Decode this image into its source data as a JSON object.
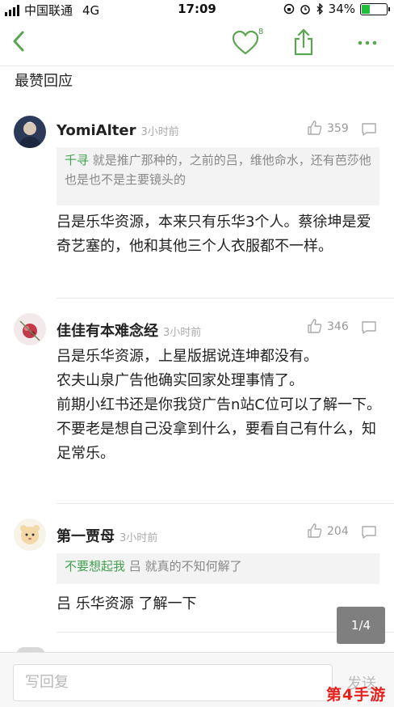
{
  "status_bar": {
    "carrier": "中国联通",
    "network": "4G",
    "time": "17:09",
    "battery": "34%",
    "battery_level": 0.34
  },
  "nav": {
    "like_count": "8"
  },
  "section_title": "最赞回应",
  "comments": [
    {
      "name": "YomiAlter",
      "time": "3小时前",
      "likes": "359",
      "quote_name": "千寻",
      "quote_text": "就是推广那种的，之前的吕，维他命水，还有芭莎他也是也不是主要镜头的",
      "body": "吕是乐华资源，本来只有乐华3个人。蔡徐坤是爱奇艺塞的，他和其他三个人衣服都不一样。"
    },
    {
      "name": "佳佳有本难念经",
      "time": "3小时前",
      "likes": "346",
      "body_lines": [
        "吕是乐华资源，上星版据说连坤都没有。",
        "农夫山泉广告他确实回家处理事情了。",
        "前期小红书还是你我贷广告n站C位可以了解一下。",
        "不要老是想自己没拿到什么，要看自己有什么，知足常乐。"
      ]
    },
    {
      "name": "第一贾母",
      "time": "3小时前",
      "likes": "204",
      "quote_name": "不要想起我",
      "quote_text": "吕 就真的不知何解了",
      "body": "吕 乐华资源 了解一下"
    }
  ],
  "page_indicator": "1/4",
  "reply_placeholder": "写回复",
  "send_label": "发送",
  "watermark": "第4手游",
  "colors": {
    "accent_green": "#42a050",
    "icon_green": "#5aa552"
  }
}
